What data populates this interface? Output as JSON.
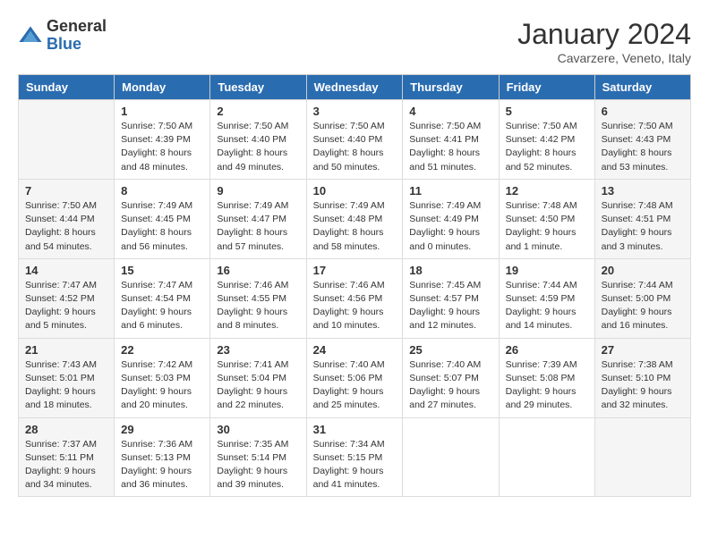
{
  "logo": {
    "general": "General",
    "blue": "Blue"
  },
  "title": "January 2024",
  "location": "Cavarzere, Veneto, Italy",
  "days_header": [
    "Sunday",
    "Monday",
    "Tuesday",
    "Wednesday",
    "Thursday",
    "Friday",
    "Saturday"
  ],
  "weeks": [
    [
      {
        "num": "",
        "info": ""
      },
      {
        "num": "1",
        "info": "Sunrise: 7:50 AM\nSunset: 4:39 PM\nDaylight: 8 hours\nand 48 minutes."
      },
      {
        "num": "2",
        "info": "Sunrise: 7:50 AM\nSunset: 4:40 PM\nDaylight: 8 hours\nand 49 minutes."
      },
      {
        "num": "3",
        "info": "Sunrise: 7:50 AM\nSunset: 4:40 PM\nDaylight: 8 hours\nand 50 minutes."
      },
      {
        "num": "4",
        "info": "Sunrise: 7:50 AM\nSunset: 4:41 PM\nDaylight: 8 hours\nand 51 minutes."
      },
      {
        "num": "5",
        "info": "Sunrise: 7:50 AM\nSunset: 4:42 PM\nDaylight: 8 hours\nand 52 minutes."
      },
      {
        "num": "6",
        "info": "Sunrise: 7:50 AM\nSunset: 4:43 PM\nDaylight: 8 hours\nand 53 minutes."
      }
    ],
    [
      {
        "num": "7",
        "info": "Sunrise: 7:50 AM\nSunset: 4:44 PM\nDaylight: 8 hours\nand 54 minutes."
      },
      {
        "num": "8",
        "info": "Sunrise: 7:49 AM\nSunset: 4:45 PM\nDaylight: 8 hours\nand 56 minutes."
      },
      {
        "num": "9",
        "info": "Sunrise: 7:49 AM\nSunset: 4:47 PM\nDaylight: 8 hours\nand 57 minutes."
      },
      {
        "num": "10",
        "info": "Sunrise: 7:49 AM\nSunset: 4:48 PM\nDaylight: 8 hours\nand 58 minutes."
      },
      {
        "num": "11",
        "info": "Sunrise: 7:49 AM\nSunset: 4:49 PM\nDaylight: 9 hours\nand 0 minutes."
      },
      {
        "num": "12",
        "info": "Sunrise: 7:48 AM\nSunset: 4:50 PM\nDaylight: 9 hours\nand 1 minute."
      },
      {
        "num": "13",
        "info": "Sunrise: 7:48 AM\nSunset: 4:51 PM\nDaylight: 9 hours\nand 3 minutes."
      }
    ],
    [
      {
        "num": "14",
        "info": "Sunrise: 7:47 AM\nSunset: 4:52 PM\nDaylight: 9 hours\nand 5 minutes."
      },
      {
        "num": "15",
        "info": "Sunrise: 7:47 AM\nSunset: 4:54 PM\nDaylight: 9 hours\nand 6 minutes."
      },
      {
        "num": "16",
        "info": "Sunrise: 7:46 AM\nSunset: 4:55 PM\nDaylight: 9 hours\nand 8 minutes."
      },
      {
        "num": "17",
        "info": "Sunrise: 7:46 AM\nSunset: 4:56 PM\nDaylight: 9 hours\nand 10 minutes."
      },
      {
        "num": "18",
        "info": "Sunrise: 7:45 AM\nSunset: 4:57 PM\nDaylight: 9 hours\nand 12 minutes."
      },
      {
        "num": "19",
        "info": "Sunrise: 7:44 AM\nSunset: 4:59 PM\nDaylight: 9 hours\nand 14 minutes."
      },
      {
        "num": "20",
        "info": "Sunrise: 7:44 AM\nSunset: 5:00 PM\nDaylight: 9 hours\nand 16 minutes."
      }
    ],
    [
      {
        "num": "21",
        "info": "Sunrise: 7:43 AM\nSunset: 5:01 PM\nDaylight: 9 hours\nand 18 minutes."
      },
      {
        "num": "22",
        "info": "Sunrise: 7:42 AM\nSunset: 5:03 PM\nDaylight: 9 hours\nand 20 minutes."
      },
      {
        "num": "23",
        "info": "Sunrise: 7:41 AM\nSunset: 5:04 PM\nDaylight: 9 hours\nand 22 minutes."
      },
      {
        "num": "24",
        "info": "Sunrise: 7:40 AM\nSunset: 5:06 PM\nDaylight: 9 hours\nand 25 minutes."
      },
      {
        "num": "25",
        "info": "Sunrise: 7:40 AM\nSunset: 5:07 PM\nDaylight: 9 hours\nand 27 minutes."
      },
      {
        "num": "26",
        "info": "Sunrise: 7:39 AM\nSunset: 5:08 PM\nDaylight: 9 hours\nand 29 minutes."
      },
      {
        "num": "27",
        "info": "Sunrise: 7:38 AM\nSunset: 5:10 PM\nDaylight: 9 hours\nand 32 minutes."
      }
    ],
    [
      {
        "num": "28",
        "info": "Sunrise: 7:37 AM\nSunset: 5:11 PM\nDaylight: 9 hours\nand 34 minutes."
      },
      {
        "num": "29",
        "info": "Sunrise: 7:36 AM\nSunset: 5:13 PM\nDaylight: 9 hours\nand 36 minutes."
      },
      {
        "num": "30",
        "info": "Sunrise: 7:35 AM\nSunset: 5:14 PM\nDaylight: 9 hours\nand 39 minutes."
      },
      {
        "num": "31",
        "info": "Sunrise: 7:34 AM\nSunset: 5:15 PM\nDaylight: 9 hours\nand 41 minutes."
      },
      {
        "num": "",
        "info": ""
      },
      {
        "num": "",
        "info": ""
      },
      {
        "num": "",
        "info": ""
      }
    ]
  ]
}
